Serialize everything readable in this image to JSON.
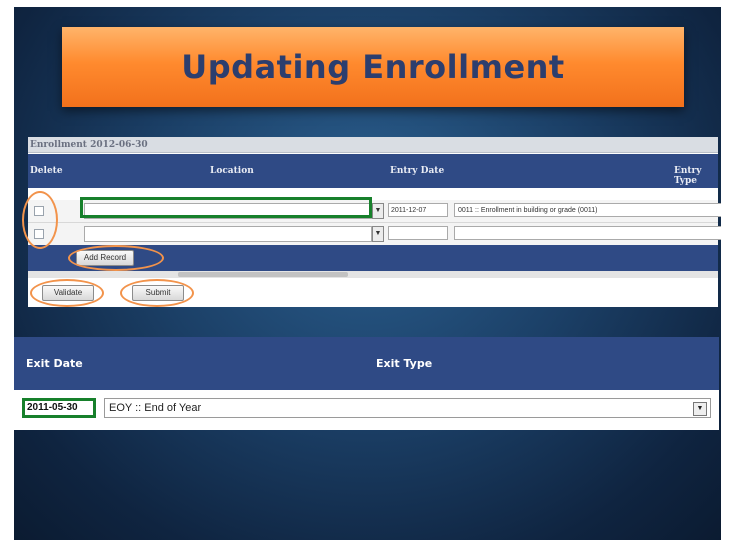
{
  "slide": {
    "title": "Updating Enrollment"
  },
  "enrollment": {
    "panel_title": "Enrollment 2012-06-30",
    "columns": {
      "delete": "Delete",
      "location": "Location",
      "entry_date": "Entry Date",
      "entry_type": "Entry Type"
    },
    "rows": [
      {
        "location": "",
        "entry_date": "2011-12-07",
        "entry_type": "0011 :: Enrollment in building or grade (0011)"
      },
      {
        "location": "",
        "entry_date": "",
        "entry_type": ""
      }
    ],
    "add_record_label": "Add Record",
    "validate_label": "Validate",
    "submit_label": "Submit"
  },
  "exit": {
    "columns": {
      "exit_date": "Exit Date",
      "exit_type": "Exit Type"
    },
    "exit_date_value": "2011-05-30",
    "exit_type_value": "EOY :: End of Year"
  },
  "icons": {
    "dropdown": "chevron-down-icon",
    "arrow": "arrow-up-icon"
  },
  "colors": {
    "banner": "#f2711c",
    "header": "#2f4a85",
    "highlight": "#17802b",
    "ring": "#f2934b"
  }
}
